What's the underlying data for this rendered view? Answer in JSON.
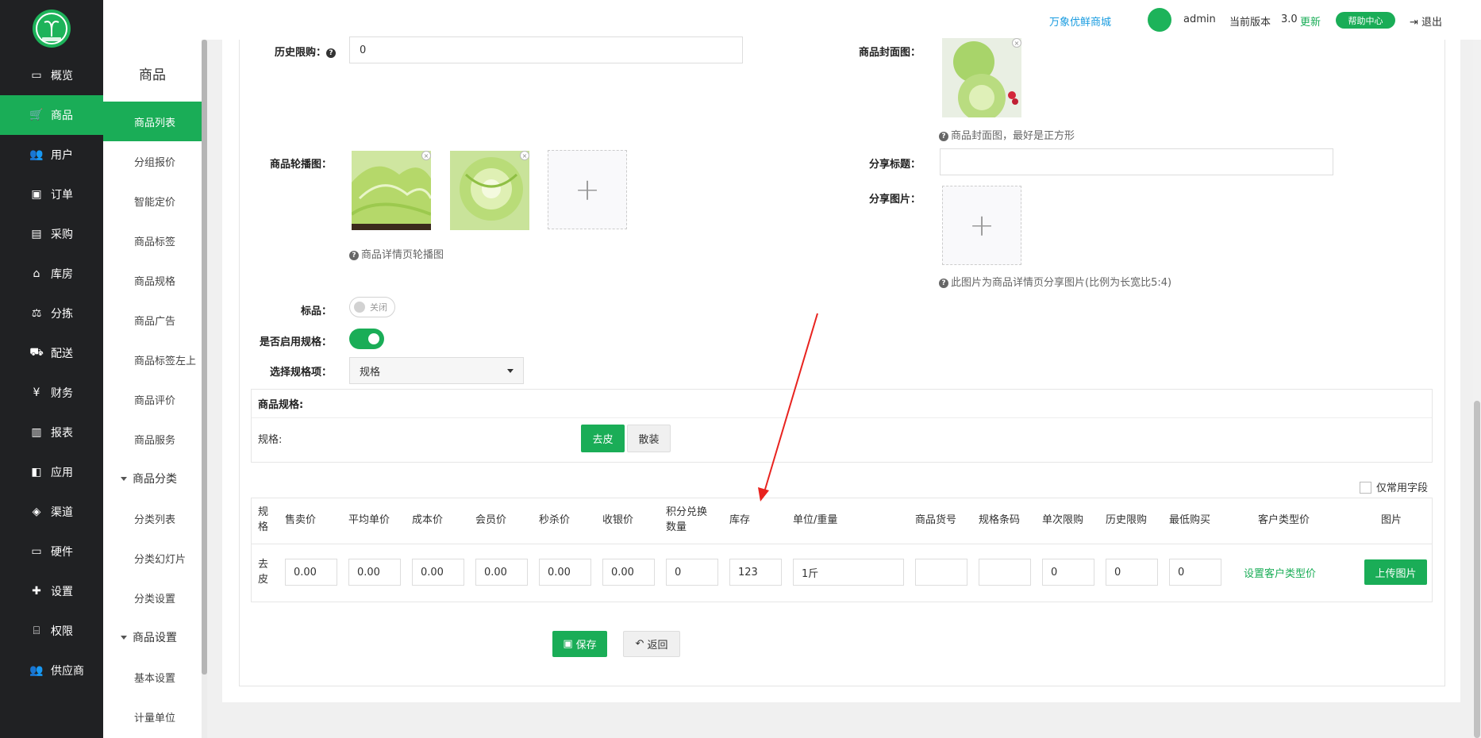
{
  "nav": {
    "items": [
      {
        "label": "概览",
        "icon": "monitor-icon"
      },
      {
        "label": "商品",
        "icon": "cart-icon"
      },
      {
        "label": "用户",
        "icon": "users-icon"
      },
      {
        "label": "订单",
        "icon": "money-icon"
      },
      {
        "label": "采购",
        "icon": "bus-icon"
      },
      {
        "label": "库房",
        "icon": "home-icon"
      },
      {
        "label": "分拣",
        "icon": "scale-icon"
      },
      {
        "label": "配送",
        "icon": "truck-icon"
      },
      {
        "label": "财务",
        "icon": "yen-icon"
      },
      {
        "label": "报表",
        "icon": "bar-chart-icon"
      },
      {
        "label": "应用",
        "icon": "apps-icon"
      },
      {
        "label": "渠道",
        "icon": "cube-icon"
      },
      {
        "label": "硬件",
        "icon": "desktop-icon"
      },
      {
        "label": "设置",
        "icon": "puzzle-icon"
      },
      {
        "label": "权限",
        "icon": "bank-icon"
      },
      {
        "label": "供应商",
        "icon": "group-icon"
      }
    ],
    "active": "商品"
  },
  "submenu": {
    "title": "商品",
    "items": [
      "商品列表",
      "分组报价",
      "智能定价",
      "商品标签",
      "商品规格",
      "商品广告",
      "商品标签左上",
      "商品评价",
      "商品服务"
    ],
    "group1": "商品分类",
    "group1_items": [
      "分类列表",
      "分类幻灯片",
      "分类设置"
    ],
    "group2": "商品设置",
    "group2_items": [
      "基本设置",
      "计量单位"
    ]
  },
  "topbar": {
    "shop": "万象优鲜商城",
    "user": "admin",
    "version_label": "当前版本",
    "version": "3.0",
    "update": "更新",
    "help": "帮助中心",
    "logout": "退出"
  },
  "form": {
    "history_limit_label": "历史限购：",
    "history_limit_value": "0",
    "cover_label": "商品封面图：",
    "cover_hint": "商品封面图，最好是正方形",
    "carousel_label": "商品轮播图：",
    "carousel_hint": "商品详情页轮播图",
    "share_title_label": "分享标题：",
    "share_title_value": "",
    "share_image_label": "分享图片：",
    "share_image_hint": "此图片为商品详情页分享图片(比例为长宽比5:4)",
    "standard_label": "标品：",
    "standard_toggle": "关闭",
    "enable_spec_label": "是否启用规格：",
    "select_spec_label": "选择规格项：",
    "select_spec_value": "规格",
    "spec_box_title": "商品规格:",
    "spec_row_label": "规格:",
    "spec_options": [
      "去皮",
      "散装"
    ],
    "common_fields_label": "仅常用字段"
  },
  "table": {
    "headers": [
      "规格",
      "售卖价",
      "平均单价",
      "成本价",
      "会员价",
      "秒杀价",
      "收银价",
      "积分兑换数量",
      "库存",
      "单位/重量",
      "商品货号",
      "规格条码",
      "单次限购",
      "历史限购",
      "最低购买",
      "客户类型价",
      "图片"
    ],
    "row": {
      "spec": "去皮",
      "sale_price": "0.00",
      "avg_price": "0.00",
      "cost_price": "0.00",
      "member_price": "0.00",
      "flash_price": "0.00",
      "cashier_price": "0.00",
      "points": "0",
      "stock": "123",
      "unit": "1斤",
      "sku": "",
      "barcode": "",
      "single_limit": "0",
      "history_limit": "0",
      "min_buy": "0",
      "customer_price_link": "设置客户类型价",
      "upload_button": "上传图片"
    }
  },
  "actions": {
    "save": "保存",
    "back": "返回"
  },
  "colors": {
    "accent": "#1aad57",
    "nav_bg": "#202123",
    "link": "#1a9ce0",
    "arrow": "#e8231f"
  }
}
